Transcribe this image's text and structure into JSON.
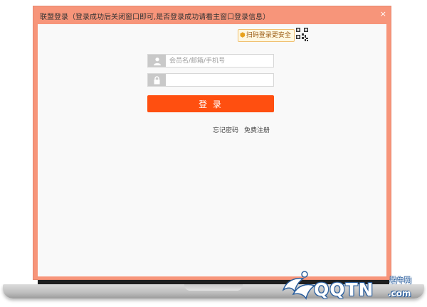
{
  "window": {
    "title": "联盟登录（登录成功后关闭窗口即可,是否登录成功请看主窗口登录信息）",
    "close_glyph": "×"
  },
  "login": {
    "qr_tip": "扫码登录更安全",
    "username": {
      "value": "",
      "placeholder": "会员名/邮箱/手机号",
      "icon": "user-icon"
    },
    "password": {
      "value": "",
      "placeholder": "",
      "icon": "lock-icon"
    },
    "submit_label": "登 录",
    "forgot_password": "忘记密码",
    "register": "免费注册"
  },
  "watermark": {
    "text": "QQTN",
    "suffix": ".com",
    "cn": "腾牛网"
  },
  "colors": {
    "window_frame": "#f7957a",
    "content_bg": "#f9f9f9",
    "primary_button": "#ff4f10",
    "icon_bg": "#c9c9c9"
  }
}
